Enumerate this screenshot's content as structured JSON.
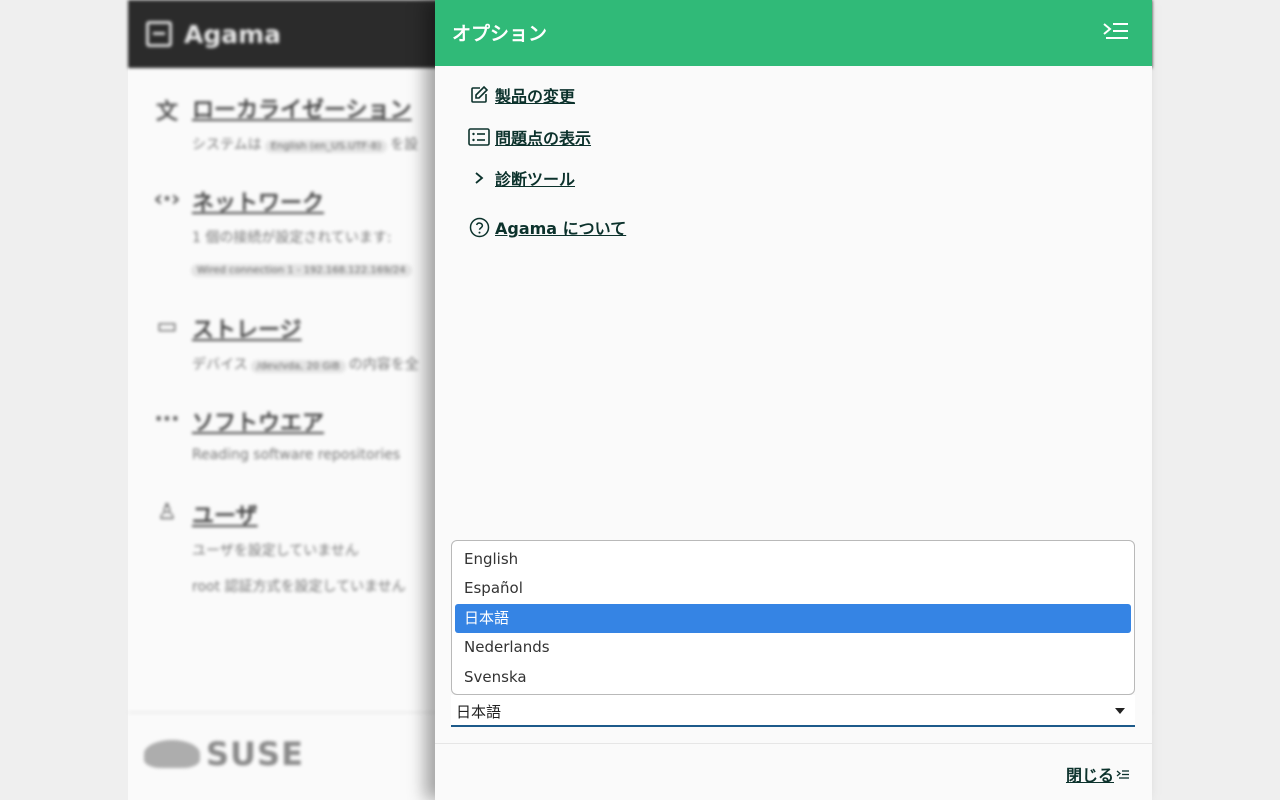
{
  "app": {
    "title": "Agama",
    "sections": [
      {
        "title": "ローカライゼーション",
        "icon": "translate-icon",
        "line1": "システムは",
        "chip": "English (en_US.UTF-8)",
        "line1b": "を設"
      },
      {
        "title": "ネットワーク",
        "icon": "network-icon",
        "line1": "1 個の接続が設定されています:",
        "chip": "Wired connection 1 - 192.168.122.169/24"
      },
      {
        "title": "ストレージ",
        "icon": "storage-icon",
        "line1": "デバイス",
        "chip": "/dev/vda, 20 GiB",
        "line1b": "の内容を全"
      },
      {
        "title": "ソフトウエア",
        "icon": "software-icon",
        "line1": "Reading software repositories"
      },
      {
        "title": "ユーザ",
        "icon": "users-icon",
        "line1": "ユーザを設定していません",
        "line2": "root 認証方式を設定していません"
      }
    ],
    "footer_brand": "SUSE"
  },
  "sidebar": {
    "title": "オプション",
    "items": [
      {
        "label": "製品の変更",
        "icon": "edit-icon"
      },
      {
        "label": "問題点の表示",
        "icon": "list-icon"
      },
      {
        "label": "診断ツール",
        "icon": "chevron-right-icon"
      },
      {
        "label": "Agama について",
        "icon": "help-circle-icon"
      }
    ],
    "language": {
      "options": [
        "English",
        "Español",
        "日本語",
        "Nederlands",
        "Svenska"
      ],
      "selected": "日本語"
    },
    "close_label": "閉じる"
  },
  "colors": {
    "accent": "#30ba78",
    "selection": "#3584e4",
    "link": "#0c322c"
  }
}
